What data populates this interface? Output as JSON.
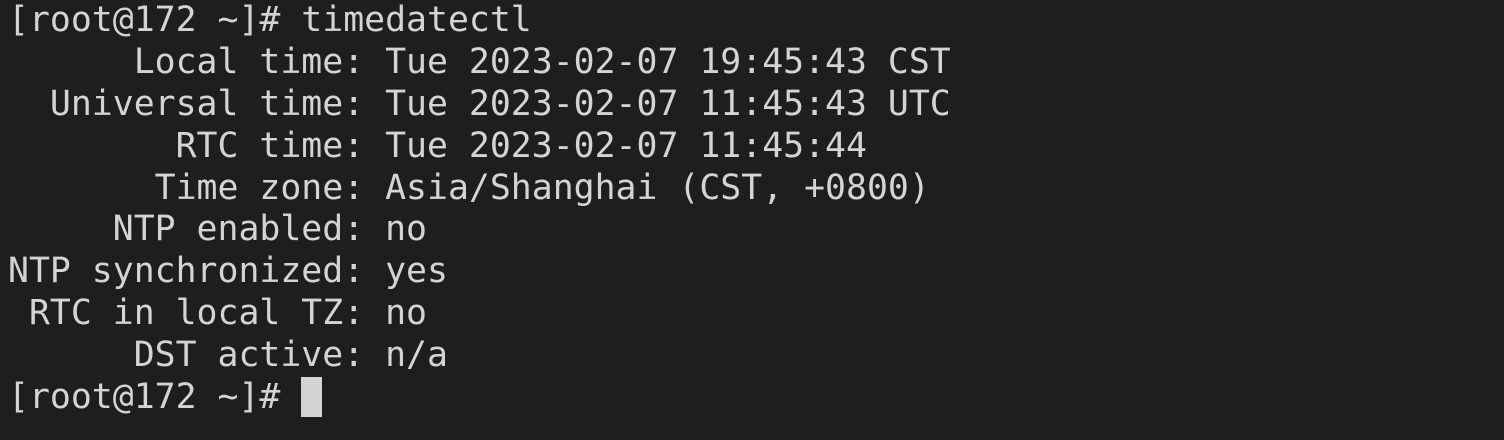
{
  "terminal": {
    "prompt": "[root@172 ~]#",
    "command": "timedatectl",
    "output": [
      {
        "label": "      Local time:",
        "value": "Tue 2023-02-07 19:45:43 CST"
      },
      {
        "label": "  Universal time:",
        "value": "Tue 2023-02-07 11:45:43 UTC"
      },
      {
        "label": "        RTC time:",
        "value": "Tue 2023-02-07 11:45:44"
      },
      {
        "label": "       Time zone:",
        "value": "Asia/Shanghai (CST, +0800)"
      },
      {
        "label": "     NTP enabled:",
        "value": "no"
      },
      {
        "label": "NTP synchronized:",
        "value": "yes"
      },
      {
        "label": " RTC in local TZ:",
        "value": "no"
      },
      {
        "label": "      DST active:",
        "value": "n/a"
      }
    ],
    "final_prompt": "[root@172 ~]#"
  },
  "colors": {
    "background": "#1e1e1e",
    "foreground": "#d4d4d4"
  }
}
